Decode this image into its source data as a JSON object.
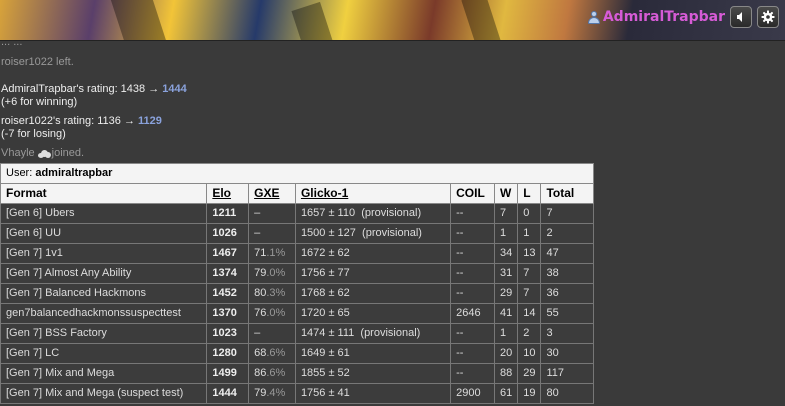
{
  "header": {
    "username": "AdmiralTrapbar",
    "user_icon": "user-icon",
    "sound_icon": "sound-icon",
    "settings_icon": "gear-icon"
  },
  "log": {
    "partial_line": "... ...",
    "left_msg": "roiser1022 left.",
    "rating1": {
      "prefix": "AdmiralTrapbar's rating: 1438 → ",
      "new": "1444",
      "change": "(+6 for winning)"
    },
    "rating2": {
      "prefix": "roiser1022's rating: 1136 → ",
      "new": "1129",
      "change": "(-7 for losing)"
    },
    "joined": {
      "user": "Vhayle",
      "suffix": "joined."
    }
  },
  "ladder": {
    "user_label": "User: ",
    "user_name": "admiraltrapbar",
    "headers": [
      "Format",
      "Elo",
      "GXE",
      "Glicko-1",
      "COIL",
      "W",
      "L",
      "Total"
    ],
    "rows": [
      {
        "format": "[Gen 6] Ubers",
        "elo": "1211",
        "gxe_int": "–",
        "gxe_dec": "",
        "glicko": "1657 ± 110",
        "prov": "(provisional)",
        "coil": "--",
        "w": "7",
        "l": "0",
        "total": "7"
      },
      {
        "format": "[Gen 6] UU",
        "elo": "1026",
        "gxe_int": "–",
        "gxe_dec": "",
        "glicko": "1500 ± 127",
        "prov": "(provisional)",
        "coil": "--",
        "w": "1",
        "l": "1",
        "total": "2"
      },
      {
        "format": "[Gen 7] 1v1",
        "elo": "1467",
        "gxe_int": "71",
        "gxe_dec": ".1%",
        "glicko": "1672 ± 62",
        "prov": "",
        "coil": "--",
        "w": "34",
        "l": "13",
        "total": "47"
      },
      {
        "format": "[Gen 7] Almost Any Ability",
        "elo": "1374",
        "gxe_int": "79",
        "gxe_dec": ".0%",
        "glicko": "1756 ± 77",
        "prov": "",
        "coil": "--",
        "w": "31",
        "l": "7",
        "total": "38"
      },
      {
        "format": "[Gen 7] Balanced Hackmons",
        "elo": "1452",
        "gxe_int": "80",
        "gxe_dec": ".3%",
        "glicko": "1768 ± 62",
        "prov": "",
        "coil": "--",
        "w": "29",
        "l": "7",
        "total": "36"
      },
      {
        "format": "gen7balancedhackmonssuspecttest",
        "elo": "1370",
        "gxe_int": "76",
        "gxe_dec": ".0%",
        "glicko": "1720 ± 65",
        "prov": "",
        "coil": "2646",
        "w": "41",
        "l": "14",
        "total": "55"
      },
      {
        "format": "[Gen 7] BSS Factory",
        "elo": "1023",
        "gxe_int": "–",
        "gxe_dec": "",
        "glicko": "1474 ± 111",
        "prov": "(provisional)",
        "coil": "--",
        "w": "1",
        "l": "2",
        "total": "3"
      },
      {
        "format": "[Gen 7] LC",
        "elo": "1280",
        "gxe_int": "68",
        "gxe_dec": ".6%",
        "glicko": "1649 ± 61",
        "prov": "",
        "coil": "--",
        "w": "20",
        "l": "10",
        "total": "30"
      },
      {
        "format": "[Gen 7] Mix and Mega",
        "elo": "1499",
        "gxe_int": "86",
        "gxe_dec": ".6%",
        "glicko": "1855 ± 52",
        "prov": "",
        "coil": "--",
        "w": "88",
        "l": "29",
        "total": "117"
      },
      {
        "format": "[Gen 7] Mix and Mega (suspect test)",
        "elo": "1444",
        "gxe_int": "79",
        "gxe_dec": ".4%",
        "glicko": "1756 ± 41",
        "prov": "",
        "coil": "2900",
        "w": "61",
        "l": "19",
        "total": "80"
      }
    ]
  }
}
